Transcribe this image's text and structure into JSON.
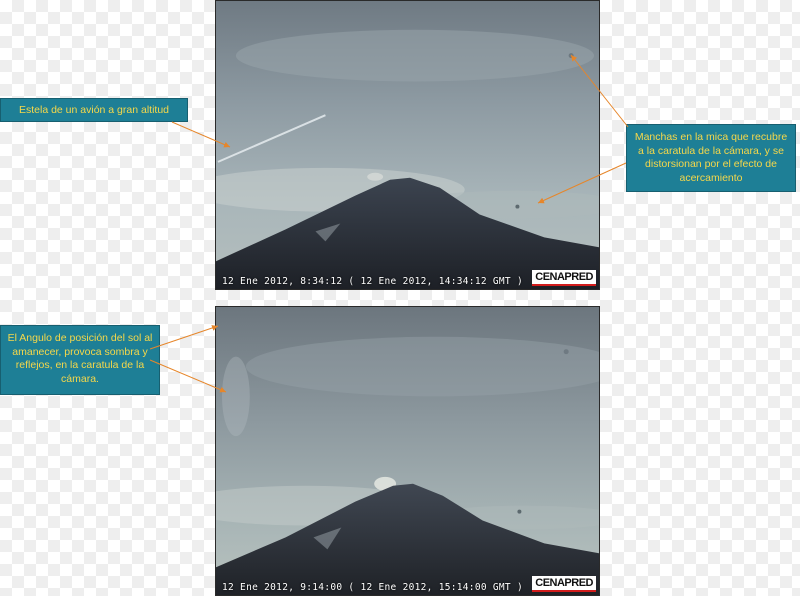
{
  "annotations": {
    "contrail": "Estela de un avión a gran altitud",
    "lens_spots": "Manchas en la mica que recubre a la caratula de la cámara, y se distorsionan por el efecto de acercamiento",
    "sun_angle": "El Angulo de posición del sol al amanecer, provoca sombra y reflejos, en la caratula de la cámara."
  },
  "frames": [
    {
      "timestamp": "12 Ene 2012, 8:34:12 ( 12 Ene 2012, 14:34:12 GMT )",
      "logo": "CENAPRED"
    },
    {
      "timestamp": "12 Ene 2012, 9:14:00 ( 12 Ene 2012, 15:14:00 GMT )",
      "logo": "CENAPRED"
    }
  ],
  "colors": {
    "annotation_bg": "#1e7f96",
    "annotation_text": "#f6d84a",
    "arrow": "#e6862a"
  }
}
